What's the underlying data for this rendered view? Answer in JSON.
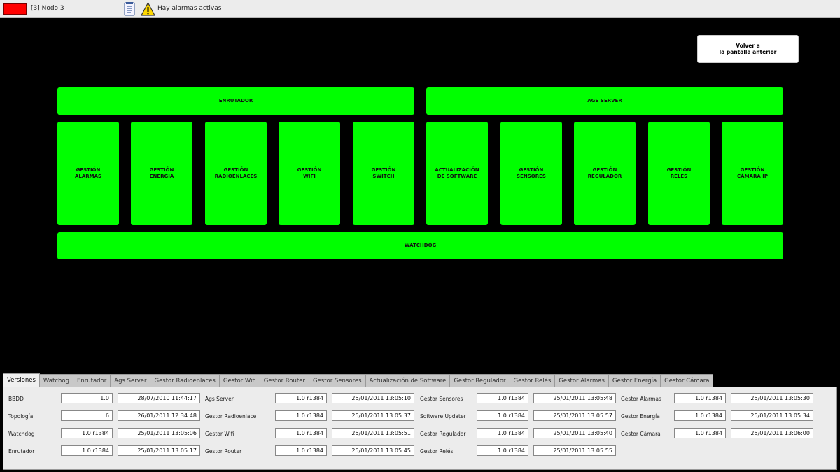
{
  "topbar": {
    "node_label": "[3] Nodo 3",
    "alarm_text": "Hay alarmas activas",
    "node_indicator_color": "#ff0000",
    "icons": [
      "alarm-list-icon",
      "warning-icon"
    ]
  },
  "back_button": {
    "line1": "Volver a",
    "line2": "la pantalla anterior"
  },
  "modules": {
    "enrutador": "ENRUTADOR",
    "ags_server": "AGS SERVER",
    "watchdog": "WATCHDOG",
    "items": [
      {
        "line1": "GESTIÓN",
        "line2": "ALARMAS"
      },
      {
        "line1": "GESTIÓN",
        "line2": "ENERGÍA"
      },
      {
        "line1": "GESTIÓN",
        "line2": "RADIOENLACES"
      },
      {
        "line1": "GESTIÓN",
        "line2": "WIFI"
      },
      {
        "line1": "GESTIÓN",
        "line2": "SWITCH"
      },
      {
        "line1": "ACTUALIZACIÓN",
        "line2": "DE SOFTWARE"
      },
      {
        "line1": "GESTIÓN",
        "line2": "SENSORES"
      },
      {
        "line1": "GESTIÓN",
        "line2": "REGULADOR"
      },
      {
        "line1": "GESTIÓN",
        "line2": "RELÉS"
      },
      {
        "line1": "GESTIÓN",
        "line2": "CÁMARA IP"
      }
    ],
    "color": "#00ff00"
  },
  "tabs": [
    "Versiones",
    "Watchog",
    "Enrutador",
    "Ags Server",
    "Gestor Radioenlaces",
    "Gestor Wifi",
    "Gestor Router",
    "Gestor Sensores",
    "Actualización de Software",
    "Gestor Regulador",
    "Gestor Relés",
    "Gestor Alarmas",
    "Gestor Energía",
    "Gestor Cámara"
  ],
  "versions": {
    "col1": [
      {
        "label": "BBDD",
        "version": "1.0",
        "date": "28/07/2010 11:44:17"
      },
      {
        "label": "Topología",
        "version": "6",
        "date": "26/01/2011 12:34:48"
      },
      {
        "label": "Watchdog",
        "version": "1.0 r1384",
        "date": "25/01/2011 13:05:06"
      },
      {
        "label": "Enrutador",
        "version": "1.0 r1384",
        "date": "25/01/2011 13:05:17"
      }
    ],
    "col2": [
      {
        "label": "Ags Server",
        "version": "1.0 r1384",
        "date": "25/01/2011 13:05:10"
      },
      {
        "label": "Gestor Radioenlace",
        "version": "1.0 r1384",
        "date": "25/01/2011 13:05:37"
      },
      {
        "label": "Gestor Wifi",
        "version": "1.0 r1384",
        "date": "25/01/2011 13:05:51"
      },
      {
        "label": "Gestor Router",
        "version": "1.0 r1384",
        "date": "25/01/2011 13:05:45"
      }
    ],
    "col3": [
      {
        "label": "Gestor Sensores",
        "version": "1.0 r1384",
        "date": "25/01/2011 13:05:48"
      },
      {
        "label": "Software Updater",
        "version": "1.0 r1384",
        "date": "25/01/2011 13:05:57"
      },
      {
        "label": "Gestor Regulador",
        "version": "1.0 r1384",
        "date": "25/01/2011 13:05:40"
      },
      {
        "label": "Gestor Relés",
        "version": "1.0 r1384",
        "date": "25/01/2011 13:05:55"
      }
    ],
    "col4": [
      {
        "label": "Gestor Alarmas",
        "version": "1.0 r1384",
        "date": "25/01/2011 13:05:30"
      },
      {
        "label": "Gestor Energía",
        "version": "1.0 r1384",
        "date": "25/01/2011 13:05:34"
      },
      {
        "label": "Gestor Cámara",
        "version": "1.0 r1384",
        "date": "25/01/2011 13:06:00"
      }
    ]
  }
}
